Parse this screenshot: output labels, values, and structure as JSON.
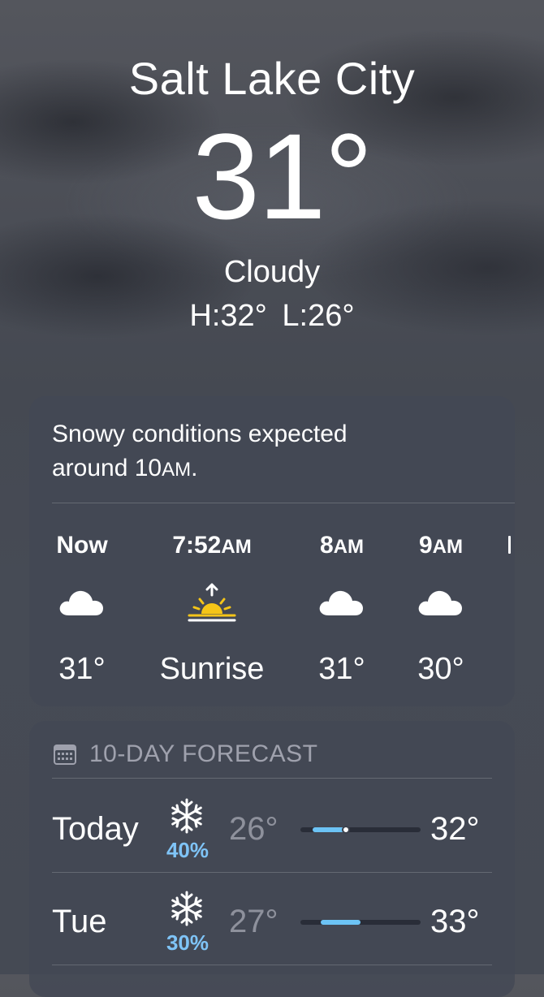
{
  "location": {
    "city": "Salt Lake City",
    "temperature": "31°",
    "condition": "Cloudy",
    "high_low": "H:32°  L:26°"
  },
  "hourly": {
    "summary_line1": "Snowy conditions expected",
    "summary_line2_pre": "around 10",
    "summary_line2_sc": "AM",
    "summary_line2_post": ".",
    "items": [
      {
        "time": "Now",
        "time_suffix": "",
        "icon": "cloud-icon",
        "value": "31°"
      },
      {
        "time": "7:52",
        "time_suffix": "AM",
        "icon": "sunrise-icon",
        "value": "Sunrise"
      },
      {
        "time": "8",
        "time_suffix": "AM",
        "icon": "cloud-icon",
        "value": "31°"
      },
      {
        "time": "9",
        "time_suffix": "AM",
        "icon": "cloud-icon",
        "value": "30°"
      }
    ]
  },
  "forecast": {
    "title": "10-DAY FORECAST",
    "icon": "calendar-icon",
    "days": [
      {
        "day": "Today",
        "icon": "snowflake-icon",
        "precip": "40%",
        "low": "26°",
        "high": "32°",
        "range_start": 0.1,
        "range_end": 0.38,
        "current_marker": 0.38
      },
      {
        "day": "Tue",
        "icon": "snowflake-icon",
        "precip": "30%",
        "low": "27°",
        "high": "33°",
        "range_start": 0.17,
        "range_end": 0.5
      }
    ]
  },
  "colors": {
    "precip": "#7fc4f7",
    "range_fill": "#6cc3f5",
    "sun": "#f5c518"
  }
}
